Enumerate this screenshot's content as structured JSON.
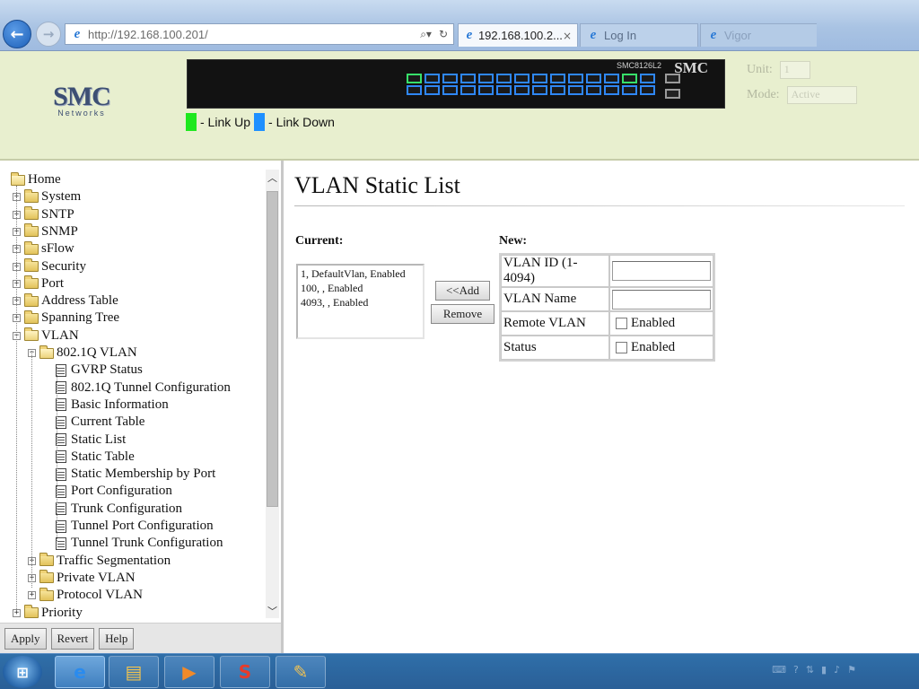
{
  "browser": {
    "url": "http://192.168.100.201/",
    "tabs": [
      {
        "label": "192.168.100.2...",
        "close": "×"
      },
      {
        "label": "Log In"
      },
      {
        "label": "Vigor"
      }
    ],
    "back_glyph": "←",
    "forward_glyph": "→",
    "tool_glyphs": [
      "⌕▾",
      "↻"
    ]
  },
  "header": {
    "logo_main": "SMC",
    "logo_sub": "Networks",
    "model": "SMC8126L2",
    "switch_logo": "SMC",
    "legend": {
      "up_label": " - Link Up",
      "down_label": " - Link Down",
      "up_color": "#1ee81e",
      "down_color": "#1e90ff"
    },
    "unit_label": "Unit:",
    "unit_value": "1",
    "mode_label": "Mode:",
    "mode_value": "Active"
  },
  "ports": {
    "group_a": [
      "up",
      "down",
      "down",
      "down",
      "down",
      "down",
      "down",
      "down",
      "down",
      "down",
      "down",
      "down"
    ],
    "group_b": [
      "down",
      "down",
      "down",
      "down",
      "down",
      "down",
      "down",
      "down",
      "down",
      "down",
      "down",
      "down"
    ],
    "group_c": [
      "up",
      "down",
      "down",
      "down"
    ]
  },
  "nav": {
    "items": [
      {
        "label": "Home",
        "type": "root"
      },
      {
        "label": "System",
        "type": "folder"
      },
      {
        "label": "SNTP",
        "type": "folder"
      },
      {
        "label": "SNMP",
        "type": "folder"
      },
      {
        "label": "sFlow",
        "type": "folder"
      },
      {
        "label": "Security",
        "type": "folder"
      },
      {
        "label": "Port",
        "type": "folder"
      },
      {
        "label": "Address Table",
        "type": "folder"
      },
      {
        "label": "Spanning Tree",
        "type": "folder"
      },
      {
        "label": "VLAN",
        "type": "folder-open"
      },
      {
        "label": "802.1Q VLAN",
        "type": "subfolder-open"
      },
      {
        "label": "GVRP Status",
        "type": "page"
      },
      {
        "label": "802.1Q Tunnel Configuration",
        "type": "page"
      },
      {
        "label": "Basic Information",
        "type": "page"
      },
      {
        "label": "Current Table",
        "type": "page"
      },
      {
        "label": "Static List",
        "type": "page"
      },
      {
        "label": "Static Table",
        "type": "page"
      },
      {
        "label": "Static Membership by Port",
        "type": "page"
      },
      {
        "label": "Port Configuration",
        "type": "page"
      },
      {
        "label": "Trunk Configuration",
        "type": "page"
      },
      {
        "label": "Tunnel Port Configuration",
        "type": "page"
      },
      {
        "label": "Tunnel Trunk Configuration",
        "type": "page"
      },
      {
        "label": "Traffic Segmentation",
        "type": "subfolder"
      },
      {
        "label": "Private VLAN",
        "type": "subfolder"
      },
      {
        "label": "Protocol VLAN",
        "type": "subfolder"
      },
      {
        "label": "Priority",
        "type": "folder"
      }
    ],
    "buttons": {
      "apply": "Apply",
      "revert": "Revert",
      "help": "Help"
    }
  },
  "content": {
    "title": "VLAN Static List",
    "current_label": "Current:",
    "new_label": "New:",
    "current_list": [
      "1, DefaultVlan, Enabled",
      "100, , Enabled",
      "4093, , Enabled"
    ],
    "add_label": "<<Add",
    "remove_label": "Remove",
    "fields": {
      "vlan_id_label": "VLAN ID (1-4094)",
      "vlan_id_value": "",
      "vlan_name_label": "VLAN Name",
      "vlan_name_value": "",
      "remote_vlan_label": "Remote VLAN",
      "remote_vlan_option": "Enabled",
      "status_label": "Status",
      "status_option": "Enabled"
    }
  },
  "taskbar": {
    "start_glyph": "⊞",
    "apps": [
      {
        "name": "Internet Explorer",
        "glyph": "e"
      },
      {
        "name": "Windows Explorer",
        "glyph": "▤"
      },
      {
        "name": "Media Player",
        "glyph": "▶"
      },
      {
        "name": "Application",
        "glyph": "S"
      },
      {
        "name": "Paint",
        "glyph": "✎"
      }
    ],
    "tray_glyphs": [
      "⌨",
      "?",
      "⇅",
      "▮",
      "♪",
      "⚑"
    ]
  }
}
